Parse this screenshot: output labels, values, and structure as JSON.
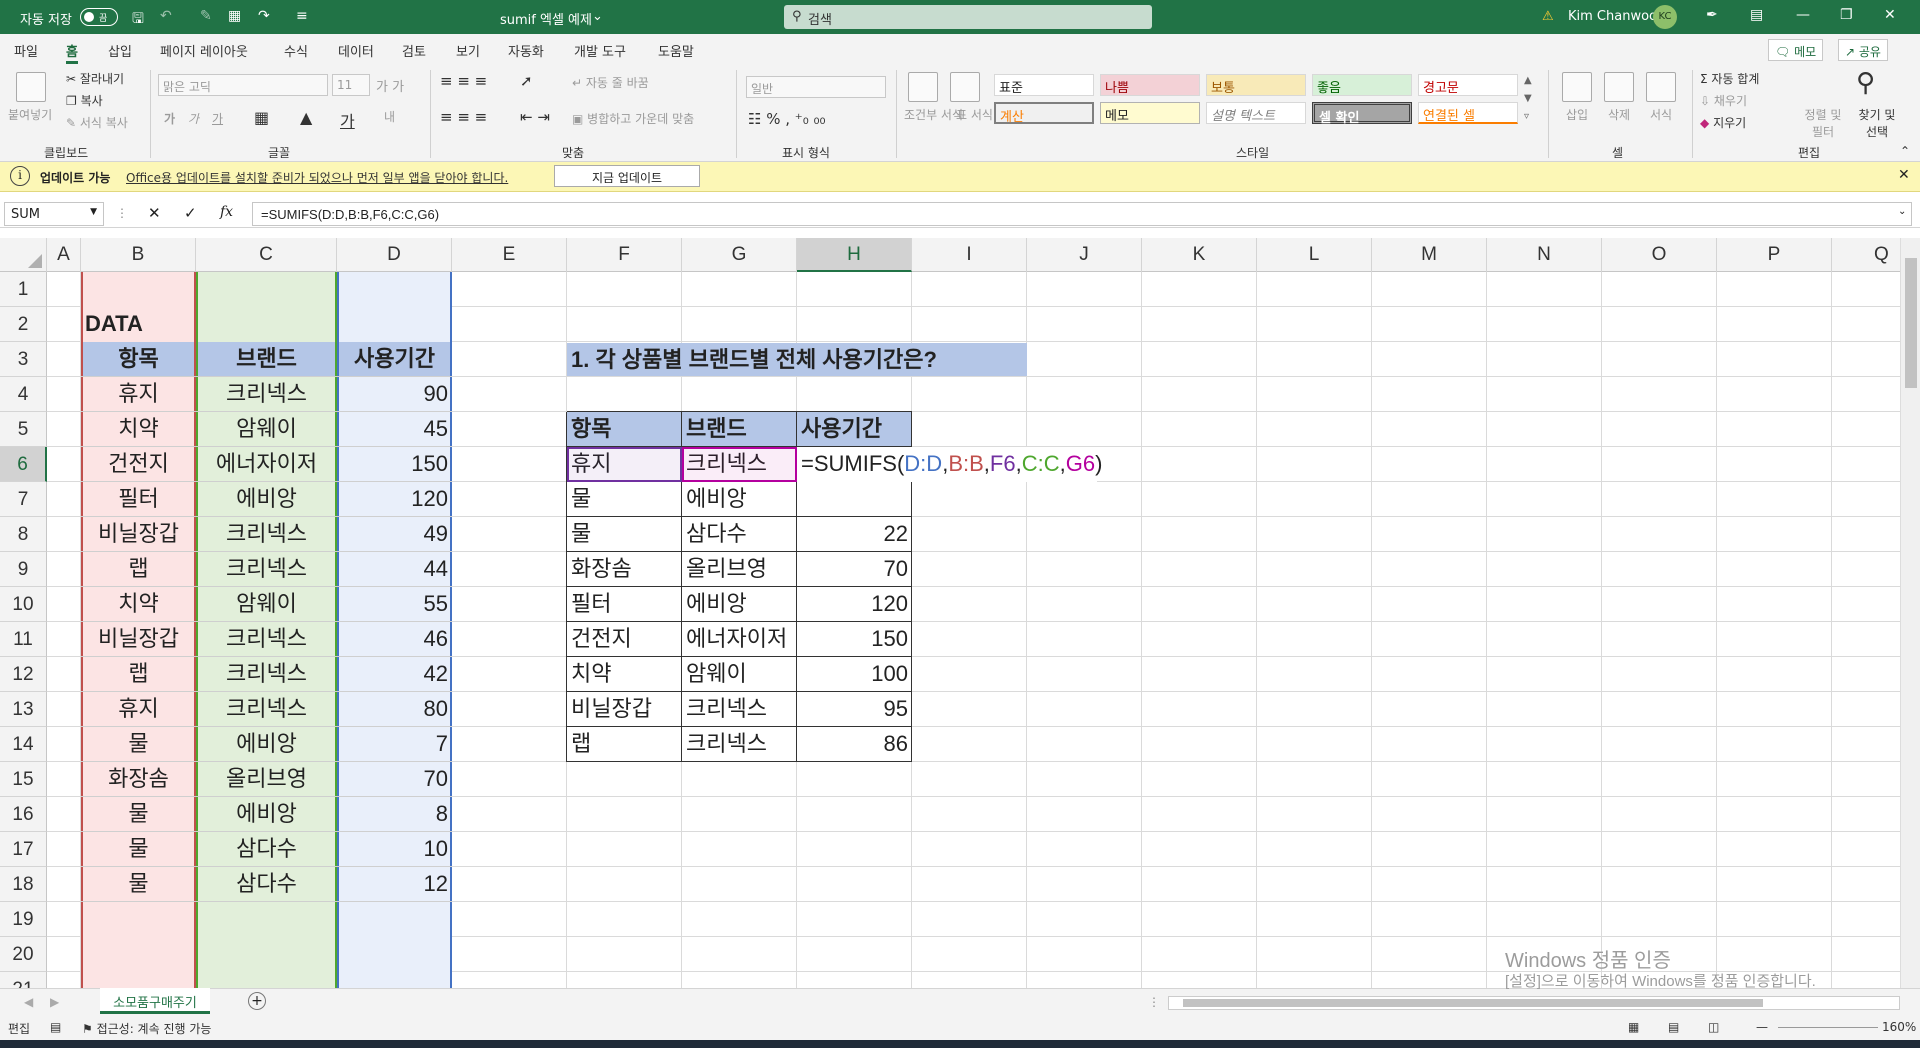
{
  "titlebar": {
    "autosave_label": "자동 저장",
    "autosave_state": "끔",
    "doc_title": "sumif 엑셀 예제",
    "search_placeholder": "검색",
    "user_name": "Kim Chanwoo",
    "user_initials": "KC"
  },
  "menu": {
    "tabs": [
      "파일",
      "홈",
      "삽입",
      "페이지 레이아웃",
      "수식",
      "데이터",
      "검토",
      "보기",
      "자동화",
      "개발 도구",
      "도움말"
    ],
    "memo_label": "메모",
    "share_label": "공유"
  },
  "ribbon": {
    "clipboard": {
      "paste": "붙여넣기",
      "cut": "잘라내기",
      "copy": "복사",
      "format_painter": "서식 복사",
      "label": "클립보드"
    },
    "font": {
      "name": "맑은 고딕",
      "size": "11",
      "label": "글꼴"
    },
    "align": {
      "wrap": "자동 줄 바꿈",
      "merge": "병합하고 가운데 맞춤",
      "label": "맞춤"
    },
    "number": {
      "format": "일반",
      "label": "표시 형식"
    },
    "styles": {
      "cond": "조건부 서식",
      "table": "표 서식",
      "cells": [
        "표준",
        "나쁨",
        "보통",
        "좋음",
        "경고문",
        "계산",
        "메모",
        "설명 텍스트",
        "셀 확인",
        "연결된 셀"
      ],
      "label": "스타일"
    },
    "cells_group": {
      "insert": "삽입",
      "delete": "삭제",
      "format": "서식",
      "label": "셀"
    },
    "editing": {
      "autosum": "자동 합계",
      "fill": "채우기",
      "clear": "지우기",
      "sort": "정렬 및 필터",
      "find": "찾기 및 선택",
      "label": "편집"
    }
  },
  "update_bar": {
    "title": "업데이트 가능",
    "message": "Office용 업데이트를 설치할 준비가 되었으나 먼저 일부 앱을 닫아야 합니다.",
    "button": "지금 업데이트"
  },
  "formula_bar": {
    "name_box": "SUM",
    "formula": "=SUMIFS(D:D,B:B,F6,C:C,G6)"
  },
  "columns": [
    "A",
    "B",
    "C",
    "D",
    "E",
    "F",
    "G",
    "H",
    "I",
    "J",
    "K",
    "L",
    "M",
    "N",
    "O",
    "P",
    "Q"
  ],
  "rows": [
    "1",
    "2",
    "3",
    "4",
    "5",
    "6",
    "7",
    "8",
    "9",
    "10",
    "11",
    "12",
    "13",
    "14",
    "15",
    "16",
    "17",
    "18",
    "19",
    "20",
    "21"
  ],
  "data_table": {
    "title": "DATA",
    "headers": [
      "항목",
      "브랜드",
      "사용기간"
    ],
    "rows": [
      [
        "휴지",
        "크리넥스",
        "90"
      ],
      [
        "치약",
        "암웨이",
        "45"
      ],
      [
        "건전지",
        "에너자이저",
        "150"
      ],
      [
        "필터",
        "에비앙",
        "120"
      ],
      [
        "비닐장갑",
        "크리넥스",
        "49"
      ],
      [
        "랩",
        "크리넥스",
        "44"
      ],
      [
        "치약",
        "암웨이",
        "55"
      ],
      [
        "비닐장갑",
        "크리넥스",
        "46"
      ],
      [
        "랩",
        "크리넥스",
        "42"
      ],
      [
        "휴지",
        "크리넥스",
        "80"
      ],
      [
        "물",
        "에비앙",
        "7"
      ],
      [
        "화장솜",
        "올리브영",
        "70"
      ],
      [
        "물",
        "에비앙",
        "8"
      ],
      [
        "물",
        "삼다수",
        "10"
      ],
      [
        "물",
        "삼다수",
        "12"
      ]
    ]
  },
  "question": {
    "title": "1. 각 상품별 브랜드별 전체 사용기간은?",
    "headers": [
      "항목",
      "브랜드",
      "사용기간"
    ],
    "rows": [
      [
        "휴지",
        "크리넥스",
        ""
      ],
      [
        "물",
        "에비앙",
        ""
      ],
      [
        "물",
        "삼다수",
        "22"
      ],
      [
        "화장솜",
        "올리브영",
        "70"
      ],
      [
        "필터",
        "에비앙",
        "120"
      ],
      [
        "건전지",
        "에너자이저",
        "150"
      ],
      [
        "치약",
        "암웨이",
        "100"
      ],
      [
        "비닐장갑",
        "크리넥스",
        "95"
      ],
      [
        "랩",
        "크리넥스",
        "86"
      ]
    ],
    "editing_formula": {
      "prefix": "=SUMIFS(",
      "a1": "D:D",
      "c1": ",",
      "a2": "B:B",
      "c2": ",",
      "a3": "F6",
      "c3": ",",
      "a4": "C:C",
      "c4": ",",
      "a5": "G6",
      "suffix": ")"
    }
  },
  "sheet_tab": "소모품구매주기",
  "status": {
    "mode": "편집",
    "accessibility": "접근성: 계속 진행 가능",
    "zoom": "160%"
  },
  "watermark": {
    "line1": "Windows 정품 인증",
    "line2": "[설정]으로 이동하여 Windows를 정품 인증합니다."
  },
  "colors": {
    "excel_green": "#217346",
    "header_blue": "#b4c6e7",
    "col_b": "#fce4e4",
    "col_c": "#e2efda",
    "col_d": "#e9effa",
    "ref_blue": "#4472c4",
    "ref_red": "#c0504d",
    "ref_purple": "#7030a0",
    "ref_green": "#4ea72e",
    "ref_magenta": "#b4009e"
  }
}
